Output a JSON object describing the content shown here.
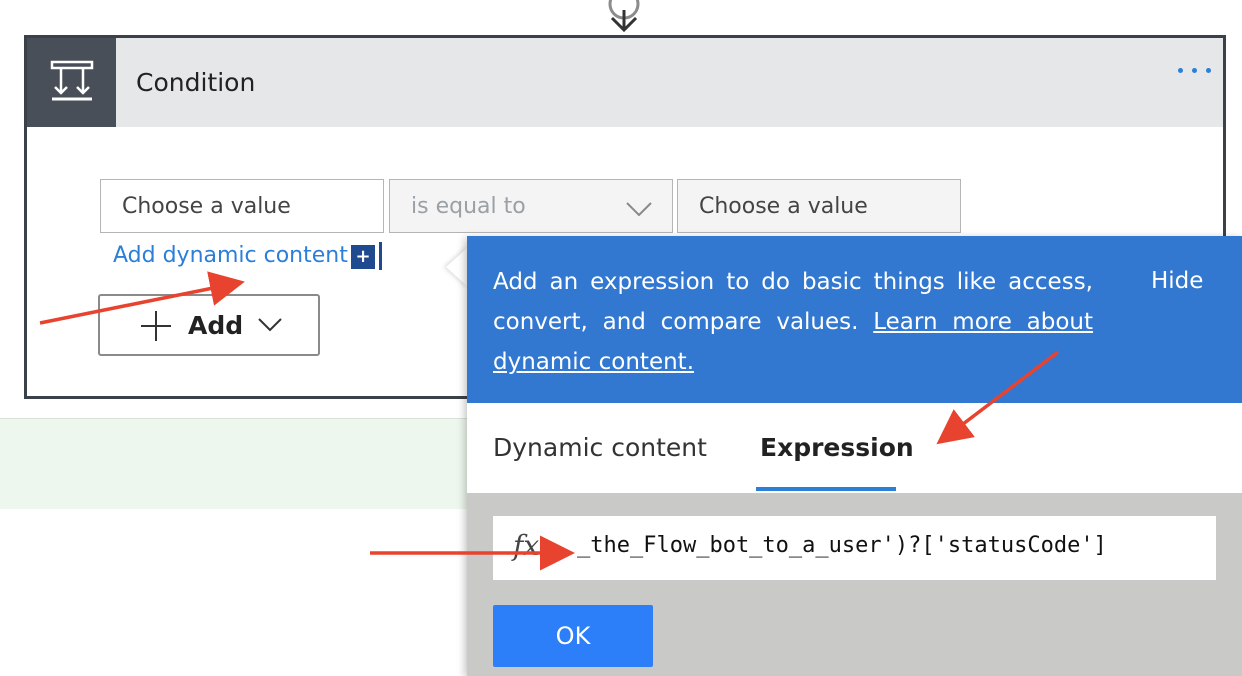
{
  "condition_card": {
    "title": "Condition",
    "left_value_placeholder": "Choose a value",
    "operator": "is equal to",
    "right_value_placeholder": "Choose a value",
    "add_dynamic_content": "Add dynamic content",
    "add_button_label": "Add"
  },
  "popup": {
    "info_text": "Add an expression to do basic things like access, convert, and compare values.",
    "info_link": "Learn more about dynamic content.",
    "hide_label": "Hide",
    "tabs": [
      {
        "label": "Dynamic content",
        "selected": false
      },
      {
        "label": "Expression",
        "selected": true
      }
    ],
    "expression_value": "_the_Flow_bot_to_a_user')?['statusCode']",
    "ok_label": "OK"
  },
  "colors": {
    "accent_blue": "#3278d0",
    "ok_button": "#2d7ff9",
    "annotation_red": "#e8432e",
    "header_dark": "#484f58"
  }
}
